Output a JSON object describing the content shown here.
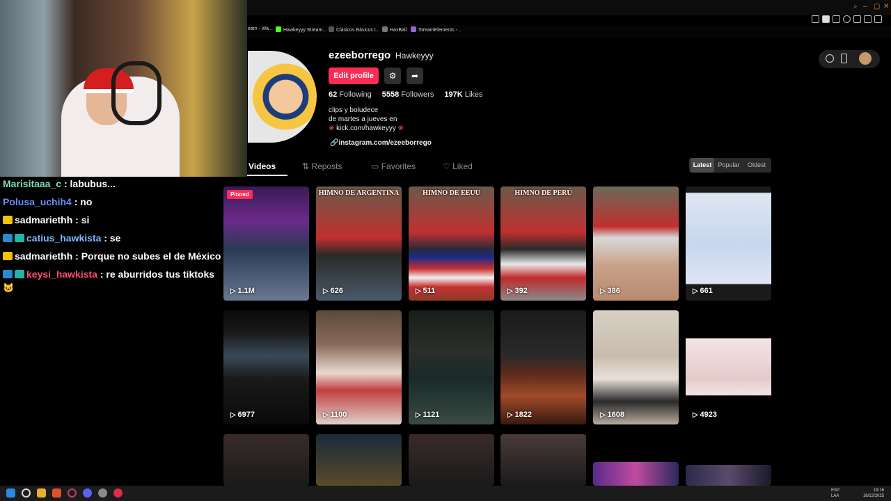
{
  "bookmarks": [
    {
      "label": "eam - Wa...",
      "color": "#2a8a3a"
    },
    {
      "label": "Hawkeyyy Stream...",
      "color": "#53fc18"
    },
    {
      "label": "Clásicos Básicos t...",
      "color": "#555555"
    },
    {
      "label": "HaxBall",
      "color": "#777777"
    },
    {
      "label": "StreamElements -...",
      "color": "#8a6ad0"
    }
  ],
  "chat": [
    {
      "user": "Marisitaaa_c",
      "message": "labubus...",
      "user_color": "#7fe0c0"
    },
    {
      "user": "Polusa_uchih4",
      "message": "no",
      "user_color": "#6b8cff"
    },
    {
      "user": "sadmariethh",
      "message": "si",
      "user_color": "#ffffff"
    },
    {
      "user": "catius_hawkista",
      "message": "se",
      "user_color": "#7fb8ff"
    },
    {
      "user": "sadmariethh",
      "message": "Porque no subes el de México",
      "user_color": "#ffffff"
    },
    {
      "user": "keysi_hawkista",
      "message": "re aburridos tus tiktoks",
      "user_color": "#ff4d6d"
    }
  ],
  "profile": {
    "username": "ezeeborrego",
    "nickname": "Hawkeyyy",
    "edit_label": "Edit profile",
    "following_count": "62",
    "following_label": "Following",
    "followers_count": "5558",
    "followers_label": "Followers",
    "likes_count": "197K",
    "likes_label": "Likes",
    "bio_line1": "clips y boludece",
    "bio_line2": "de martes a jueves en",
    "bio_line3": "kick.com/hawkeyyy",
    "link": "instagram.com/ezeeborrego"
  },
  "tabs": [
    "Videos",
    "Reposts",
    "Favorites",
    "Liked"
  ],
  "sort_options": [
    "Latest",
    "Popular",
    "Oldest"
  ],
  "videos": [
    {
      "views": "1.1M",
      "pinned": "Pinned",
      "caption": ""
    },
    {
      "views": "626",
      "caption": "HIMNO DE ARGENTINA"
    },
    {
      "views": "511",
      "caption": "HIMNO DE EEUU"
    },
    {
      "views": "392",
      "caption": "HIMNO DE PERÚ"
    },
    {
      "views": "386",
      "caption": ""
    },
    {
      "views": "661",
      "caption": ""
    },
    {
      "views": "6977",
      "caption": ""
    },
    {
      "views": "1100",
      "caption": ""
    },
    {
      "views": "1121",
      "caption": ""
    },
    {
      "views": "1822",
      "caption": ""
    },
    {
      "views": "1608",
      "caption": ""
    },
    {
      "views": "4923",
      "caption": ""
    }
  ],
  "taskbar": {
    "lang_line1": "ESP",
    "lang_line2": "LAA",
    "time": "19:16",
    "date": "16/12/2025"
  },
  "colors": {
    "accent": "#fe2c55",
    "background": "#000000"
  }
}
